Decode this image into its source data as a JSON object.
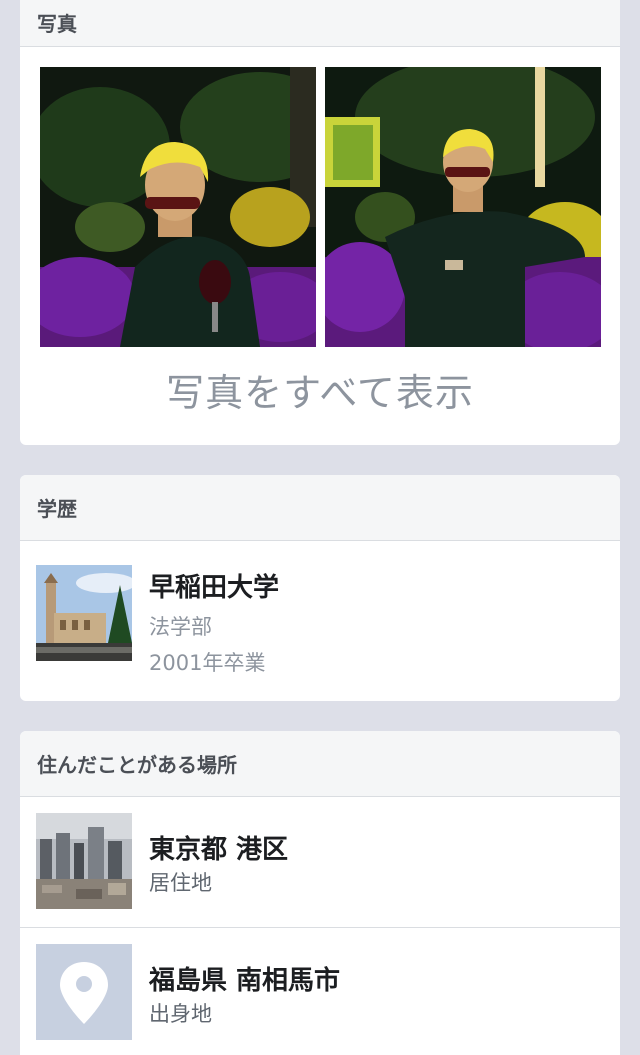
{
  "photos": {
    "header": "写真",
    "see_all_label": "写真をすべて表示",
    "items": [
      {
        "alt": "photo-1"
      },
      {
        "alt": "photo-2"
      }
    ]
  },
  "education": {
    "header": "学歴",
    "items": [
      {
        "school": "早稲田大学",
        "department": "法学部",
        "graduation": "2001年卒業"
      }
    ]
  },
  "places": {
    "header": "住んだことがある場所",
    "items": [
      {
        "name": "東京都 港区",
        "type": "居住地",
        "icon": "city-photo"
      },
      {
        "name": "福島県 南相馬市",
        "type": "出身地",
        "icon": "map-pin-icon"
      }
    ]
  },
  "colors": {
    "page_background": "#dddfe8",
    "card_background": "#ffffff",
    "header_background": "#f5f6f7",
    "muted_text": "#8d949e",
    "pin_placeholder": "#c7d0e0"
  }
}
